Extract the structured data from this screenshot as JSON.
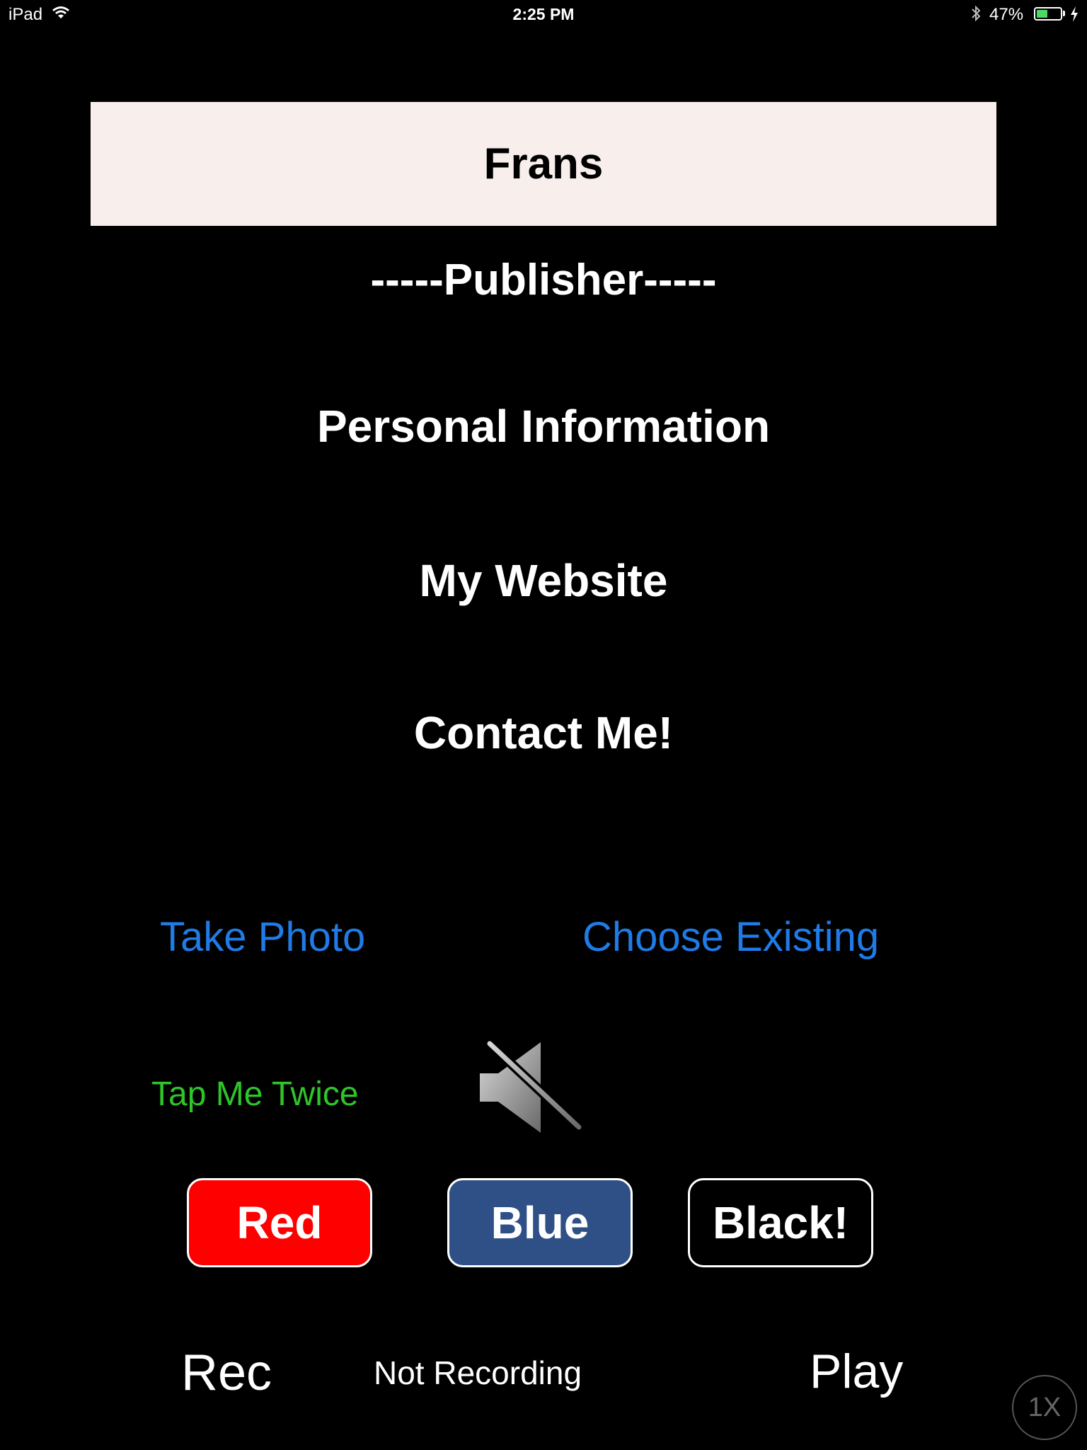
{
  "status_bar": {
    "device": "iPad",
    "time": "2:25 PM",
    "battery_percent": "47%",
    "battery_level": 0.47,
    "battery_color": "#4cd964",
    "icons": [
      "wifi-icon",
      "bluetooth-icon",
      "battery-icon",
      "charging-bolt-icon"
    ]
  },
  "header": {
    "name": "Frans",
    "background": "#f8eeec"
  },
  "section": {
    "publisher_label": "-----Publisher-----"
  },
  "menu": {
    "personal_information": "Personal Information",
    "my_website": "My Website",
    "contact_me": "Contact Me!"
  },
  "photo": {
    "take_photo": "Take Photo",
    "choose_existing": "Choose Existing",
    "link_color": "#1f7be6"
  },
  "tap": {
    "label": "Tap Me Twice",
    "color": "#2fc42a",
    "mute_icon": "speaker-muted-icon"
  },
  "color_buttons": {
    "red": "Red",
    "blue": "Blue",
    "black": "Black!",
    "red_color": "#ff0000",
    "blue_color": "#2f5086",
    "black_color": "#000000"
  },
  "recorder": {
    "rec": "Rec",
    "status": "Not Recording",
    "play": "Play"
  },
  "zoom": {
    "label": "1X"
  }
}
